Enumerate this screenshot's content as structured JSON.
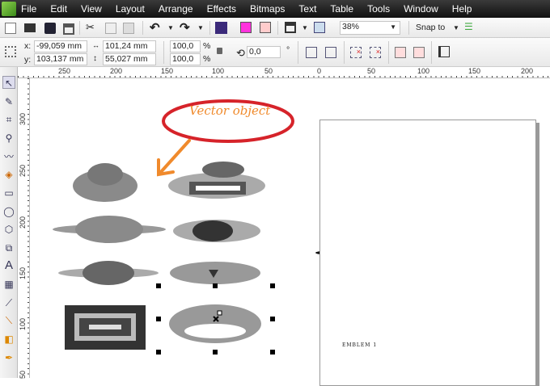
{
  "menu": [
    "File",
    "Edit",
    "View",
    "Layout",
    "Arrange",
    "Effects",
    "Bitmaps",
    "Text",
    "Table",
    "Tools",
    "Window",
    "Help"
  ],
  "toolbar": {
    "zoom": "38%",
    "snap_to": "Snap to"
  },
  "property_bar": {
    "x_label": "x:",
    "x": "-99,059 mm",
    "y_label": "y:",
    "y": "103,137 mm",
    "width": "101,24 mm",
    "height": "55,027 mm",
    "scale_x": "100,0",
    "scale_y": "100,0",
    "percent": "%",
    "rotation": "0,0",
    "degree": "°"
  },
  "ruler": {
    "h": [
      "250",
      "200",
      "150",
      "100",
      "50",
      "0",
      "50",
      "100",
      "150",
      "200"
    ],
    "v": [
      "300",
      "250",
      "200",
      "150",
      "100",
      "50"
    ]
  },
  "annotation": {
    "label": "Vector object",
    "ellipse_color": "#d6232a",
    "arrow_color": "#f08a2c"
  },
  "page": {
    "emblem_text": "EMBLEM 1"
  }
}
